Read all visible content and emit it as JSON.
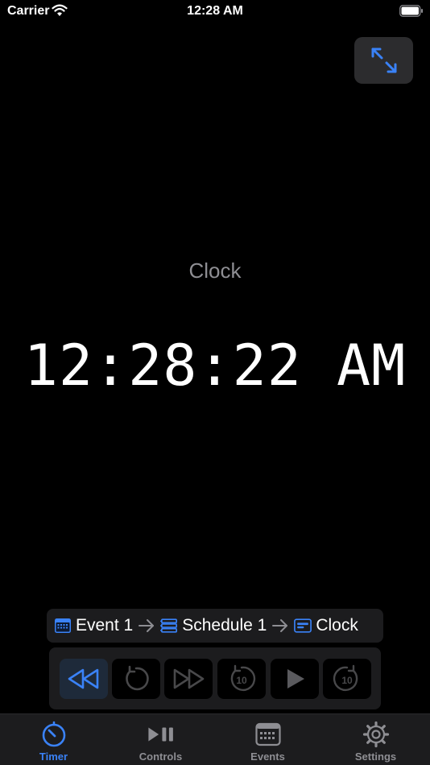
{
  "status_bar": {
    "carrier": "Carrier",
    "time": "12:28 AM"
  },
  "main": {
    "label": "Clock",
    "time": "12:28:22 AM"
  },
  "breadcrumb": {
    "items": [
      {
        "label": "Event 1",
        "icon": "calendar-icon"
      },
      {
        "label": "Schedule 1",
        "icon": "schedule-list-icon"
      },
      {
        "label": "Clock",
        "icon": "clock-card-icon"
      }
    ]
  },
  "controls": [
    "rewind-button",
    "restart-button",
    "fast-forward-button",
    "skip-back-10-button",
    "play-button",
    "skip-forward-10-button"
  ],
  "tab_bar": {
    "tabs": [
      {
        "label": "Timer",
        "icon": "timer-icon",
        "selected": true
      },
      {
        "label": "Controls",
        "icon": "play-pause-icon",
        "selected": false
      },
      {
        "label": "Events",
        "icon": "calendar-grid-icon",
        "selected": false
      },
      {
        "label": "Settings",
        "icon": "gear-icon",
        "selected": false
      }
    ]
  },
  "colors": {
    "accent": "#3a82f7",
    "panel": "#1c1c1e",
    "muted": "#8e8e93",
    "background": "#000000"
  }
}
